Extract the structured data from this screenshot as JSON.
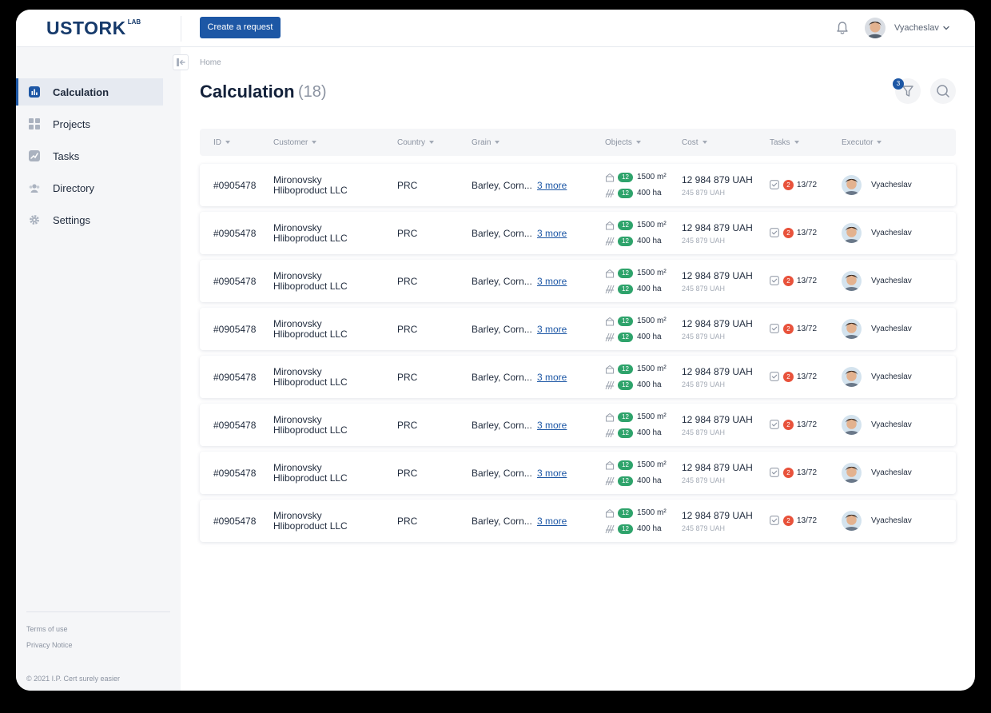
{
  "app": {
    "logo": "USTORK",
    "logo_suffix": "LAB",
    "brand_color": "#1d57a5"
  },
  "header": {
    "create_button": "Create a request",
    "user_name": "Vyacheslav",
    "icons": [
      "bell-icon",
      "chevron-down-icon"
    ]
  },
  "sidebar": {
    "items": [
      {
        "label": "Calculation",
        "icon": "chart-icon",
        "active": true
      },
      {
        "label": "Projects",
        "icon": "grid-icon",
        "active": false
      },
      {
        "label": "Tasks",
        "icon": "trend-icon",
        "active": false
      },
      {
        "label": "Directory",
        "icon": "people-icon",
        "active": false
      },
      {
        "label": "Settings",
        "icon": "gear-icon",
        "active": false
      }
    ],
    "terms": "Terms of use",
    "privacy": "Privacy Notice",
    "copyright": "© 2021 I.P. Cert surely easier"
  },
  "main": {
    "breadcrumb": "Home",
    "title": "Calculation",
    "count": "(18)",
    "filter_badge": "3",
    "columns": [
      "ID",
      "Customer",
      "Country",
      "Grain",
      "Objects",
      "Cost",
      "Tasks",
      "Executor"
    ]
  },
  "rows": [
    {
      "id": "#0905478",
      "customer_line1": "Mironovsky",
      "customer_line2": "Hliboproduct LLC",
      "country": "PRC",
      "grain": "Barley, Corn...",
      "more": "3 more",
      "obj1_badge": "12",
      "obj1_value": "1500 m²",
      "obj2_badge": "12",
      "obj2_value": "400 ha",
      "cost": "12 984 879 UAH",
      "cost_sub": "245 879 UAH",
      "task_badge": "2",
      "tasks": "13/72",
      "executor": "Vyacheslav"
    },
    {
      "id": "#0905478",
      "customer_line1": "Mironovsky",
      "customer_line2": "Hliboproduct LLC",
      "country": "PRC",
      "grain": "Barley, Corn...",
      "more": "3 more",
      "obj1_badge": "12",
      "obj1_value": "1500 m²",
      "obj2_badge": "12",
      "obj2_value": "400 ha",
      "cost": "12 984 879 UAH",
      "cost_sub": "245 879 UAH",
      "task_badge": "2",
      "tasks": "13/72",
      "executor": "Vyacheslav"
    },
    {
      "id": "#0905478",
      "customer_line1": "Mironovsky",
      "customer_line2": "Hliboproduct LLC",
      "country": "PRC",
      "grain": "Barley, Corn...",
      "more": "3 more",
      "obj1_badge": "12",
      "obj1_value": "1500 m²",
      "obj2_badge": "12",
      "obj2_value": "400 ha",
      "cost": "12 984 879 UAH",
      "cost_sub": "245 879 UAH",
      "task_badge": "2",
      "tasks": "13/72",
      "executor": "Vyacheslav"
    },
    {
      "id": "#0905478",
      "customer_line1": "Mironovsky",
      "customer_line2": "Hliboproduct LLC",
      "country": "PRC",
      "grain": "Barley, Corn...",
      "more": "3 more",
      "obj1_badge": "12",
      "obj1_value": "1500 m²",
      "obj2_badge": "12",
      "obj2_value": "400 ha",
      "cost": "12 984 879 UAH",
      "cost_sub": "245 879 UAH",
      "task_badge": "2",
      "tasks": "13/72",
      "executor": "Vyacheslav"
    },
    {
      "id": "#0905478",
      "customer_line1": "Mironovsky",
      "customer_line2": "Hliboproduct LLC",
      "country": "PRC",
      "grain": "Barley, Corn...",
      "more": "3 more",
      "obj1_badge": "12",
      "obj1_value": "1500 m²",
      "obj2_badge": "12",
      "obj2_value": "400 ha",
      "cost": "12 984 879 UAH",
      "cost_sub": "245 879 UAH",
      "task_badge": "2",
      "tasks": "13/72",
      "executor": "Vyacheslav"
    },
    {
      "id": "#0905478",
      "customer_line1": "Mironovsky",
      "customer_line2": "Hliboproduct LLC",
      "country": "PRC",
      "grain": "Barley, Corn...",
      "more": "3 more",
      "obj1_badge": "12",
      "obj1_value": "1500 m²",
      "obj2_badge": "12",
      "obj2_value": "400 ha",
      "cost": "12 984 879 UAH",
      "cost_sub": "245 879 UAH",
      "task_badge": "2",
      "tasks": "13/72",
      "executor": "Vyacheslav"
    },
    {
      "id": "#0905478",
      "customer_line1": "Mironovsky",
      "customer_line2": "Hliboproduct LLC",
      "country": "PRC",
      "grain": "Barley, Corn...",
      "more": "3 more",
      "obj1_badge": "12",
      "obj1_value": "1500 m²",
      "obj2_badge": "12",
      "obj2_value": "400 ha",
      "cost": "12 984 879 UAH",
      "cost_sub": "245 879 UAH",
      "task_badge": "2",
      "tasks": "13/72",
      "executor": "Vyacheslav"
    },
    {
      "id": "#0905478",
      "customer_line1": "Mironovsky",
      "customer_line2": "Hliboproduct LLC",
      "country": "PRC",
      "grain": "Barley, Corn...",
      "more": "3 more",
      "obj1_badge": "12",
      "obj1_value": "1500 m²",
      "obj2_badge": "12",
      "obj2_value": "400 ha",
      "cost": "12 984 879 UAH",
      "cost_sub": "245 879 UAH",
      "task_badge": "2",
      "tasks": "13/72",
      "executor": "Vyacheslav"
    }
  ]
}
